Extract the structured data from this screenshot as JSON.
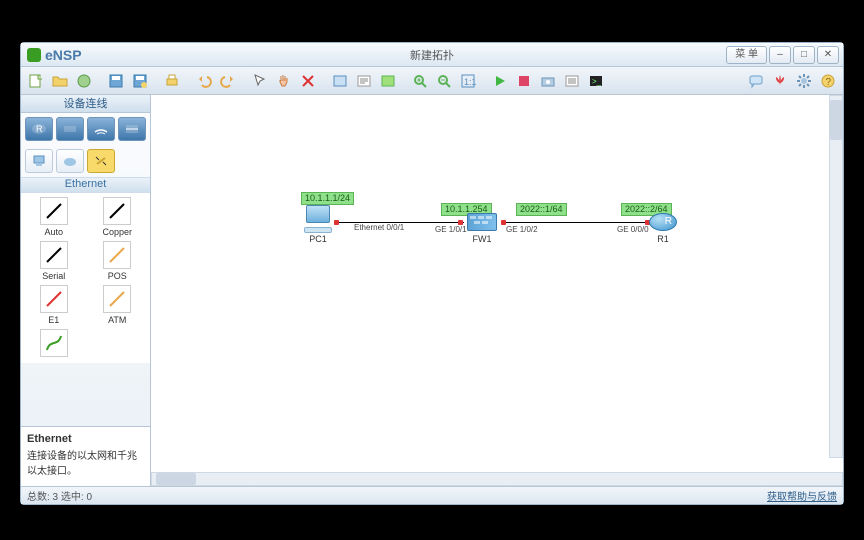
{
  "app": {
    "name": "eNSP",
    "title": "新建拓扑"
  },
  "win": {
    "menu": "菜 单",
    "min": "–",
    "max": "□",
    "close": "✕"
  },
  "sidebar": {
    "panel_title": "设备连线",
    "sub_title": "Ethernet",
    "tools": {
      "auto": "Auto",
      "copper": "Copper",
      "serial": "Serial",
      "pos": "POS",
      "e1": "E1",
      "atm": "ATM"
    },
    "info": {
      "title": "Ethernet",
      "body": "连接设备的以太网和千兆以太接口。"
    }
  },
  "topology": {
    "pc1": {
      "name": "PC1",
      "ip": "10.1.1.1/24",
      "port_out": "Ethernet 0/0/1"
    },
    "fw1": {
      "name": "FW1",
      "ip_left": "10.1.1.254",
      "ip_right": "2022::1/64",
      "port_left": "GE 1/0/1",
      "port_right": "GE 1/0/2"
    },
    "r1": {
      "name": "R1",
      "ip": "2022::2/64",
      "port_in": "GE 0/0/0"
    }
  },
  "status": {
    "left": "总数: 3  选中: 0",
    "right": "获取帮助与反馈"
  }
}
